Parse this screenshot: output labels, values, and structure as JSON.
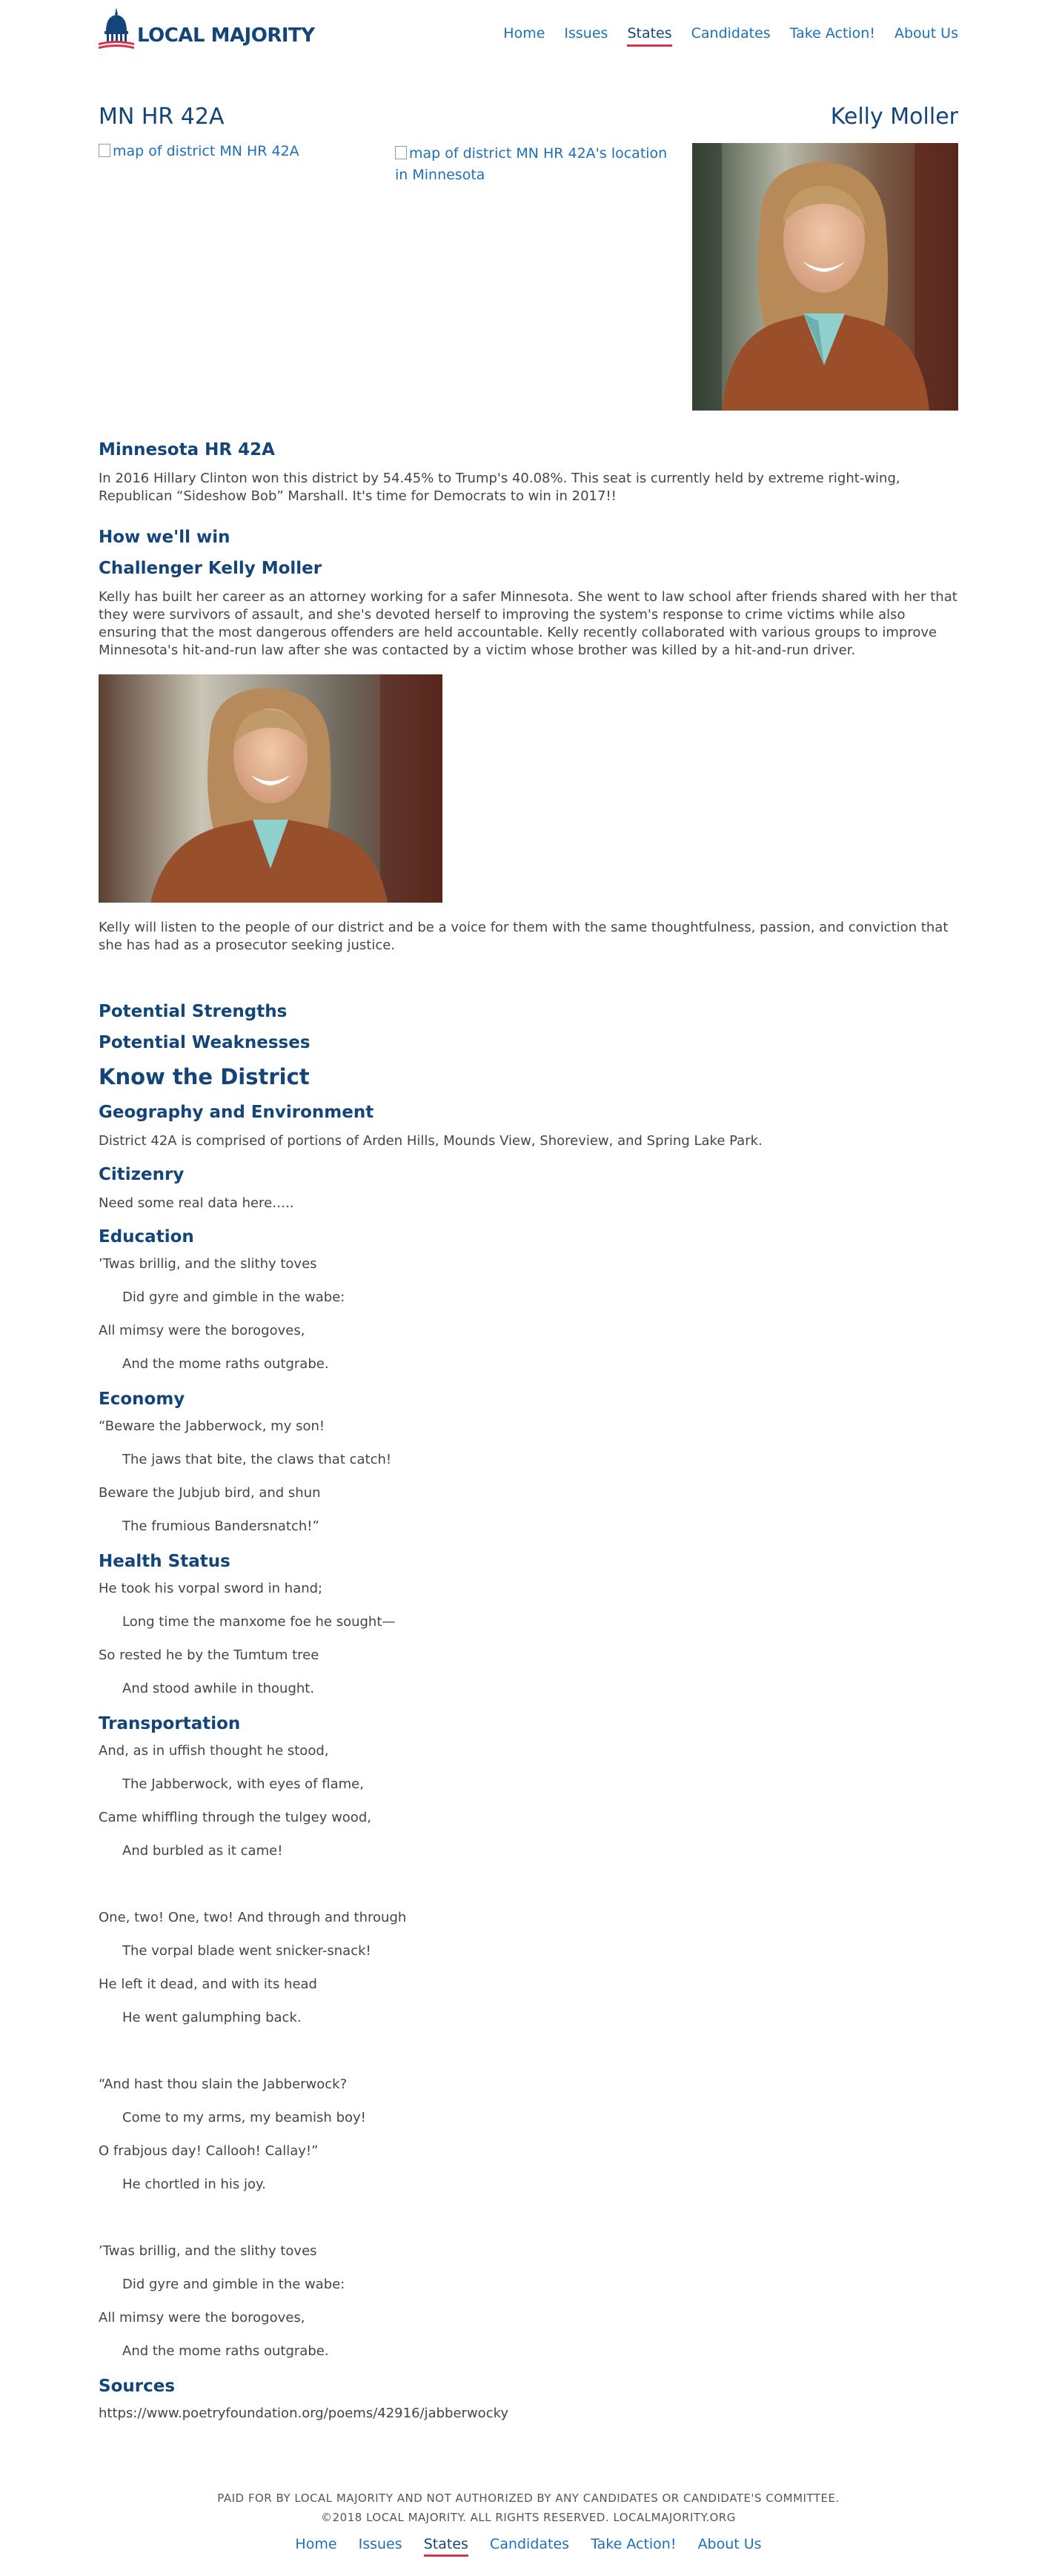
{
  "brand": {
    "logo_text": "LOCAL MAJORITY",
    "color_primary": "#14457a",
    "color_link": "#1d70b7",
    "color_accent": "#d9324a"
  },
  "nav": [
    "Home",
    "Issues",
    "States",
    "Candidates",
    "Take Action!",
    "About Us"
  ],
  "nav_active": "States",
  "district": {
    "title": "MN HR 42A",
    "candidate": "Kelly Moller",
    "map_alt_1": "map of district MN HR 42A",
    "map_alt_2": "map of district MN HR 42A's location in Minnesota"
  },
  "main": {
    "heading": "Minnesota HR 42A",
    "intro": "In 2016 Hillary Clinton won this district by 54.45% to Trump's 40.08%. This seat is currently held by extreme right-wing, Republican “Sideshow Bob” Marshall. It's time for Democrats to win in 2017!!",
    "how_heading": "How we'll win",
    "challenger_heading": "Challenger Kelly Moller",
    "challenger_bio": "Kelly has built her career as an attorney working for a safer Minnesota. She went to law school after friends shared with her that they were survivors of assault, and she's devoted herself to improving the system's response to crime victims while also ensuring that the most dangerous offenders are held accountable. Kelly recently collaborated with various groups to improve Minnesota's hit-and-run law after she was contacted by a victim whose brother was killed by a hit-and-run driver.",
    "listen_text": "Kelly will listen to the people of our district and be a voice for them with the same thoughtfulness, passion, and conviction that she has had as a prosecutor seeking justice.",
    "strengths_heading": "Potential Strengths",
    "weaknesses_heading": "Potential Weaknesses",
    "know_heading": "Know the District",
    "geo_heading": "Geography and Environment",
    "geo_text": "District 42A is comprised of portions of Arden Hills, Mounds View, Shoreview, and Spring Lake Park.",
    "citizenry_heading": "Citizenry",
    "citizenry_text": "Need some real data here…..",
    "education_heading": "Education",
    "education_lines": [
      "’Twas brillig, and the slithy toves",
      "Did gyre and gimble in the wabe:",
      "All mimsy were the borogoves,",
      "And the mome raths outgrabe."
    ],
    "economy_heading": "Economy",
    "economy_lines": [
      "“Beware the Jabberwock, my son!",
      "The jaws that bite, the claws that catch!",
      "Beware the Jubjub bird, and shun",
      "The frumious Bandersnatch!”"
    ],
    "health_heading": "Health Status",
    "health_lines": [
      "He took his vorpal sword in hand;",
      "Long time the manxome foe he sought—",
      "So rested he by the Tumtum tree",
      "And stood awhile in thought."
    ],
    "transport_heading": "Transportation",
    "transport_stanza1": [
      " And, as in uffish thought he stood,",
      "The Jabberwock, with eyes of flame,",
      "Came whiffling through the tulgey wood,",
      "And burbled as it came!"
    ],
    "transport_stanza2": [
      "One, two! One, two! And through and through",
      "The vorpal blade went snicker-snack!",
      "He left it dead, and with its head",
      "He went galumphing back."
    ],
    "transport_stanza3": [
      "“And hast thou slain the Jabberwock?",
      "Come to my arms, my beamish boy!",
      "O frabjous day! Callooh! Callay!”",
      "He chortled in his joy."
    ],
    "transport_stanza4": [
      "’Twas brillig, and the slithy toves",
      "Did gyre and gimble in the wabe:",
      "All mimsy were the borogoves,",
      "And the mome raths outgrabe."
    ],
    "sources_heading": "Sources",
    "source_url": "https://www.poetryfoundation.org/poems/42916/jabberwocky"
  },
  "footer": {
    "paid_for": "PAID FOR BY LOCAL MAJORITY AND NOT AUTHORIZED BY ANY CANDIDATES OR CANDIDATE'S COMMITTEE.",
    "copyright": "©2018 LOCAL MAJORITY. ALL RIGHTS RESERVED. LOCALMAJORITY.ORG"
  }
}
